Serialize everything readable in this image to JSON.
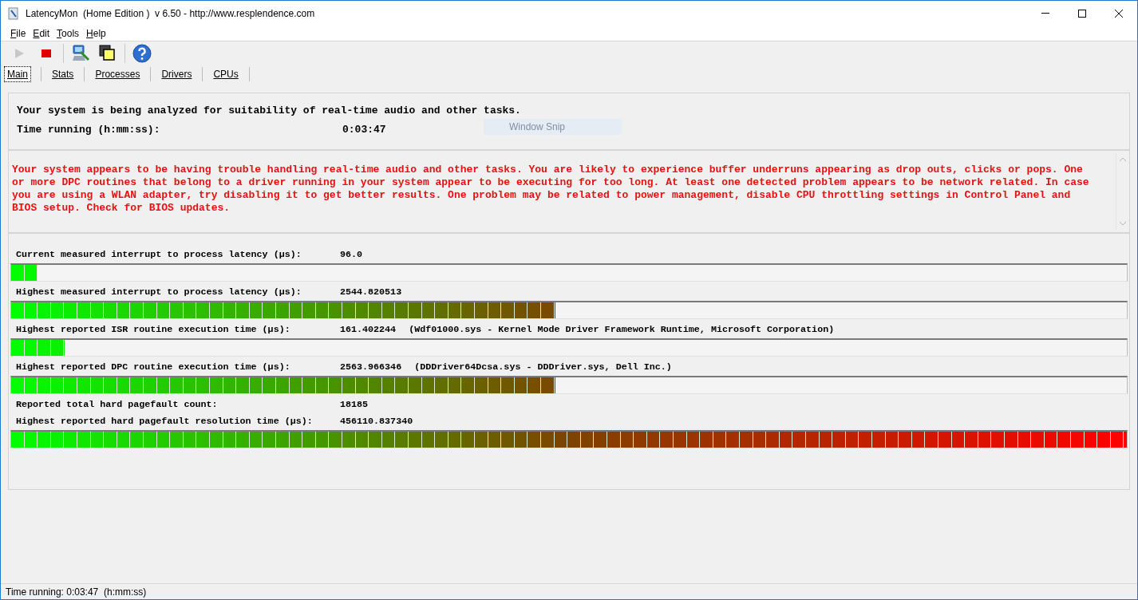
{
  "window": {
    "title": "LatencyMon  (Home Edition )  v 6.50 - http://www.resplendence.com"
  },
  "menu": [
    "File",
    "Edit",
    "Tools",
    "Help"
  ],
  "toolbar": [
    {
      "kind": "play",
      "disabled": true
    },
    {
      "kind": "stop",
      "disabled": false
    },
    {
      "kind": "separator"
    },
    {
      "kind": "analyze",
      "disabled": false
    },
    {
      "kind": "windows",
      "disabled": false
    },
    {
      "kind": "separator"
    },
    {
      "kind": "help",
      "disabled": false
    }
  ],
  "tabs": [
    {
      "label": "Main",
      "selected": true
    },
    {
      "label": "Stats",
      "selected": false
    },
    {
      "label": "Processes",
      "selected": false
    },
    {
      "label": "Drivers",
      "selected": false
    },
    {
      "label": "CPUs",
      "selected": false
    }
  ],
  "summary": {
    "status": "Your system is being analyzed for suitability of real-time audio and other tasks.",
    "time_label": "Time running (h:mm:ss):",
    "time_value": "0:03:47"
  },
  "overlay_hint": "Window Snip",
  "message": "Your system appears to be having trouble handling real-time audio and other tasks. You are likely to experience buffer underruns appearing as drop outs, clicks or pops. One or more DPC routines that belong to a driver running in your system appear to be executing for too long. At least one detected problem appears to be network related. In case you are using a WLAN adapter, try disabling it to get better results. One problem may be related to power management, disable CPU throttling settings in Control Panel and BIOS setup. Check for BIOS updates.",
  "metrics": [
    {
      "kind": "meter",
      "label": "Current measured interrupt to process latency (µs):",
      "value": "96.0",
      "level": 0.024
    },
    {
      "kind": "meter",
      "label": "Highest measured interrupt to process latency (µs):",
      "value": "2544.820513",
      "level": 0.49
    },
    {
      "kind": "meter",
      "label": "Highest reported ISR routine execution time (µs):",
      "value": "161.402244",
      "detail": "(Wdf01000.sys - Kernel Mode Driver Framework Runtime, Microsoft Corporation)",
      "level": 0.048
    },
    {
      "kind": "meter",
      "label": "Highest reported DPC routine execution time (µs):",
      "value": "2563.966346",
      "detail": "(DDDriver64Dcsa.sys - DDDriver.sys, Dell Inc.)",
      "level": 0.49
    },
    {
      "kind": "plain",
      "label": "Reported total hard pagefault count:",
      "value": "18185"
    },
    {
      "kind": "meter",
      "label": "Highest reported hard pagefault resolution time (µs):",
      "value": "456110.837340",
      "level": 1.0
    }
  ],
  "status_bar": "Time running: 0:03:47  (h:mm:ss)"
}
